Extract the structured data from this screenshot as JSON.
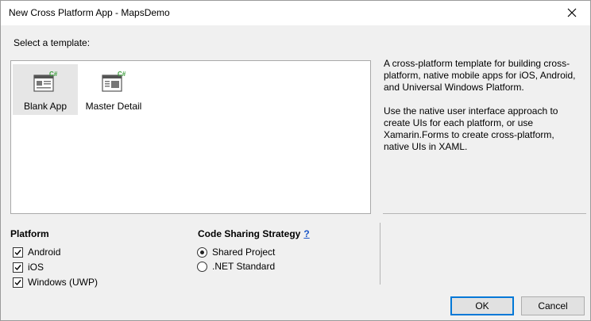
{
  "window": {
    "title": "New Cross Platform App - MapsDemo"
  },
  "template_section": {
    "label": "Select a template:",
    "templates": [
      {
        "name": "Blank App",
        "icon": "csharp-blank-app-template-icon",
        "selected": true
      },
      {
        "name": "Master Detail",
        "icon": "csharp-master-detail-template-icon",
        "selected": false
      }
    ]
  },
  "description": {
    "paragraph1": "A cross-platform template for building cross-platform, native mobile apps for iOS, Android, and Universal Windows Platform.",
    "paragraph2": "Use the native user interface approach to create UIs for each platform, or use Xamarin.Forms to create cross-platform, native UIs in XAML."
  },
  "platform": {
    "title": "Platform",
    "options": [
      {
        "label": "Android",
        "checked": true
      },
      {
        "label": "iOS",
        "checked": true
      },
      {
        "label": "Windows (UWP)",
        "checked": true
      }
    ]
  },
  "code_sharing": {
    "title": "Code Sharing Strategy",
    "help": "?",
    "options": [
      {
        "label": "Shared Project",
        "selected": true
      },
      {
        "label": ".NET Standard",
        "selected": false
      }
    ]
  },
  "buttons": {
    "ok": "OK",
    "cancel": "Cancel"
  },
  "colors": {
    "accent": "#0078d7",
    "help_link": "#1a55c7",
    "csharp_badge": "#3c9e3c"
  }
}
